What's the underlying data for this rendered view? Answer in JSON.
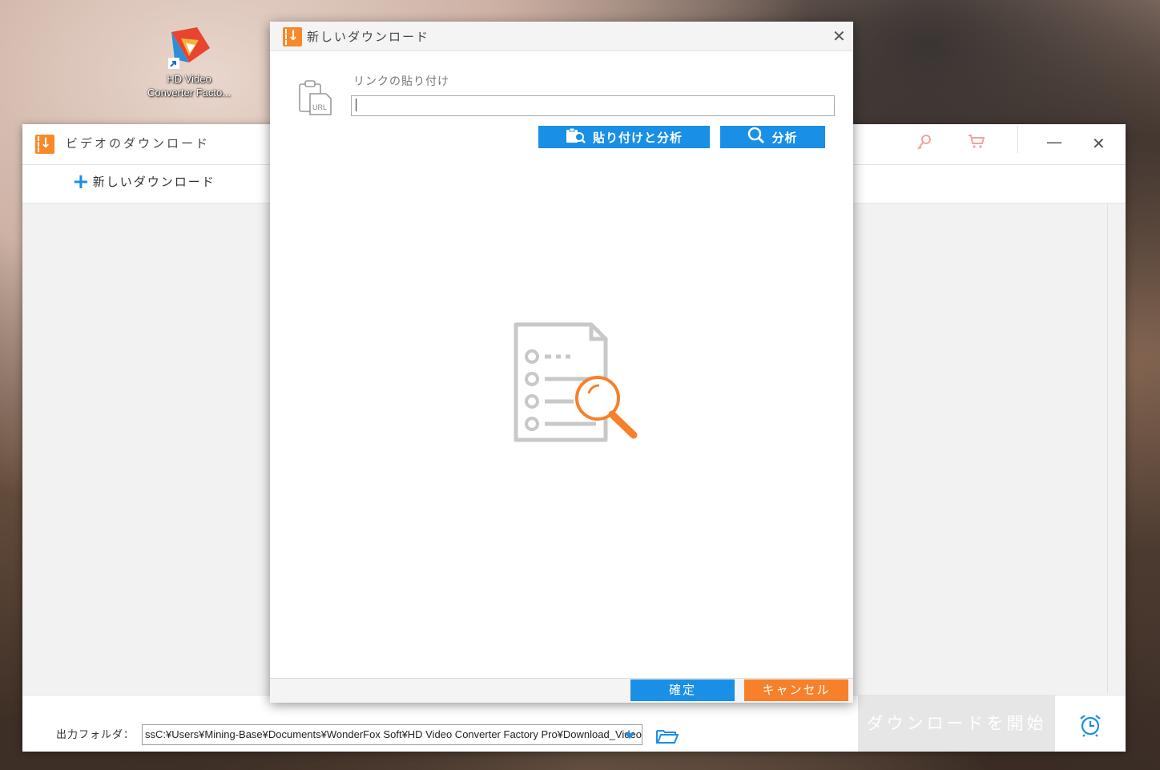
{
  "desktop": {
    "icon_label_line1": "HD Video",
    "icon_label_line2": "Converter Facto..."
  },
  "main_window": {
    "title": "ビデオのダウンロード",
    "new_download_label": "新しいダウンロード",
    "output_folder_label": "出力フォルダ：",
    "output_path": "ssC:¥Users¥Mining-Base¥Documents¥WonderFox Soft¥HD Video Converter Factory Pro¥Download_Video",
    "start_download_label": "ダウンロードを開始"
  },
  "dialog": {
    "title": "新しいダウンロード",
    "paste_link_label": "リンクの貼り付け",
    "url_value": "",
    "paste_analyze_label": "貼り付けと分析",
    "analyze_label": "分析",
    "ok_label": "確定",
    "cancel_label": "キャンセル"
  },
  "icons": {
    "url_icon_text": "URL"
  },
  "colors": {
    "accent_blue": "#1a8fe6",
    "accent_orange": "#f7802a",
    "disabled_gray": "#e6e6e6"
  }
}
